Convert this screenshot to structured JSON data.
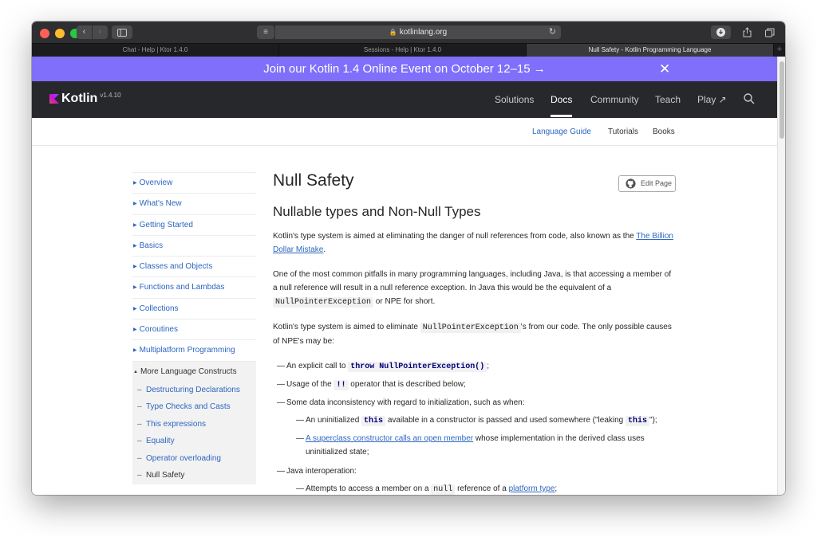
{
  "browser": {
    "url": "kotlinlang.org",
    "tabs": [
      {
        "title": "Chat - Help | Ktor 1.4.0",
        "active": false
      },
      {
        "title": "Sessions - Help | Ktor 1.4.0",
        "active": false
      },
      {
        "title": "Null Safety - Kotlin Programming Language",
        "active": true
      }
    ],
    "new_tab": "+"
  },
  "banner": {
    "text": "Join our Kotlin 1.4 Online Event on October 12–15 →",
    "close": "✕",
    "color": "#7f6ffa"
  },
  "header": {
    "logo": "Kotlin",
    "version": "v1.4.10",
    "nav": {
      "solutions": "Solutions",
      "docs": "Docs",
      "community": "Community",
      "teach": "Teach",
      "play": "Play ↗"
    }
  },
  "subnav": {
    "language_guide": "Language Guide",
    "tutorials": "Tutorials",
    "books": "Books"
  },
  "toc": {
    "items": [
      "Overview",
      "What's New",
      "Getting Started",
      "Basics",
      "Classes and Objects",
      "Functions and Lambdas",
      "Collections",
      "Coroutines",
      "Multiplatform Programming"
    ],
    "expanded": "More Language Constructs",
    "sub_items": [
      "Destructuring Declarations",
      "Type Checks and Casts",
      "This expressions",
      "Equality",
      "Operator overloading",
      "Null Safety"
    ]
  },
  "content": {
    "title": "Null Safety",
    "edit_label": "Edit Page",
    "h2": "Nullable types and Non-Null Types",
    "p1_text": "Kotlin's type system is aimed at eliminating the danger of null references from code, also known as the ",
    "p1_link": "The Billion Dollar Mistake",
    "p1_end": ".",
    "p2_text": "One of the most common pitfalls in many programming languages, including Java, is that accessing a member of a null reference will result in a null reference exception. In Java this would be the equivalent of a ",
    "p2_code": "NullPointerException",
    "p2_end": " or NPE for short.",
    "p3_text": "Kotlin's type system is aimed to eliminate ",
    "p3_code": "NullPointerException",
    "p3_end": "'s from our code. The only possible causes of NPE's may be:",
    "li1_text": "An explicit call to ",
    "li1_code": "throw NullPointerException()",
    "li1_end": ";",
    "li2_text": "Usage of the ",
    "li2_code": "!!",
    "li2_end": " operator that is described below;",
    "li3_text": "Some data inconsistency with regard to initialization, such as when:",
    "li3a_text": "An uninitialized ",
    "li3a_code": "this",
    "li3a_mid": " available in a constructor is passed and used somewhere (\"leaking ",
    "li3a_code2": "this",
    "li3a_end": "\");",
    "li3b_link": "A superclass constructor calls an open member",
    "li3b_end": " whose implementation in the derived class uses uninitialized state;",
    "li4_text": "Java interoperation:",
    "li4a_text": "Attempts to access a member on a ",
    "li4a_code": "null",
    "li4a_mid": " reference of a ",
    "li4a_link": "platform type",
    "li4a_end": ";"
  }
}
